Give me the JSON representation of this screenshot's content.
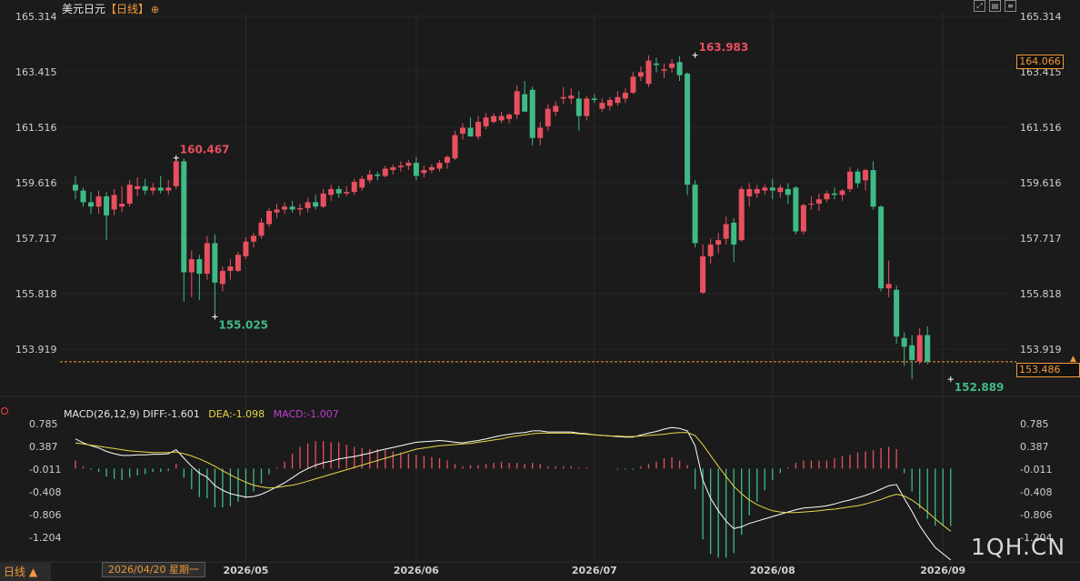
{
  "header": {
    "symbol": "美元日元",
    "timeframe_tag": "【日线】",
    "pin_icon": "target-icon",
    "tools": [
      "expand-icon",
      "layout-icon",
      "menu-icon"
    ]
  },
  "macd": {
    "diff_label": "MACD(26,12,9) DIFF:-1.601",
    "dea_label": "DEA:-1.098",
    "macd_label": "MACD:-1.007"
  },
  "footer": {
    "timeframe_button": "日线 ▲",
    "cursor_date": "2026/04/20 星期一"
  },
  "tags": {
    "current_price": "164.066",
    "last_price": "153.486"
  },
  "watermark": "1QH.CN",
  "colors": {
    "background": "#1b1b1b",
    "up": "#e8505f",
    "down": "#3fba86",
    "diff_line": "#ffffff",
    "dea_line": "#e8d84a",
    "accent": "#f39a3a"
  },
  "chart_data": [
    {
      "type": "candlestick",
      "title": "美元日元",
      "y_ticks": [
        "165.314",
        "163.415",
        "161.516",
        "159.616",
        "157.717",
        "155.818",
        "153.919"
      ],
      "ylim": [
        153.3,
        165.314
      ],
      "x_ticks": [
        {
          "label": "2026/05",
          "index": 22
        },
        {
          "label": "2026/06",
          "index": 44
        },
        {
          "label": "2026/07",
          "index": 67
        },
        {
          "label": "2026/08",
          "index": 90
        },
        {
          "label": "2026/09",
          "index": 112
        }
      ],
      "annotations": [
        {
          "label": "160.467",
          "index": 13,
          "value": 160.467,
          "kind": "high"
        },
        {
          "label": "155.025",
          "index": 18,
          "value": 155.025,
          "kind": "low"
        },
        {
          "label": "163.983",
          "index": 80,
          "value": 163.983,
          "kind": "high"
        },
        {
          "label": "152.889",
          "index": 113,
          "value": 152.889,
          "kind": "low"
        }
      ],
      "reference_line": 153.486,
      "ohlc": [
        [
          159.55,
          159.85,
          159.05,
          159.35
        ],
        [
          159.35,
          159.45,
          158.8,
          158.95
        ],
        [
          158.95,
          159.3,
          158.55,
          158.8
        ],
        [
          158.8,
          159.35,
          158.55,
          159.15
        ],
        [
          159.15,
          159.3,
          157.65,
          158.5
        ],
        [
          158.7,
          159.4,
          158.5,
          159.2
        ],
        [
          158.8,
          159.5,
          158.6,
          158.9
        ],
        [
          158.9,
          159.7,
          158.8,
          159.55
        ],
        [
          159.4,
          159.8,
          159.15,
          159.5
        ],
        [
          159.5,
          159.75,
          159.2,
          159.35
        ],
        [
          159.35,
          159.6,
          159.2,
          159.45
        ],
        [
          159.45,
          159.85,
          159.25,
          159.35
        ],
        [
          159.35,
          159.7,
          159.2,
          159.45
        ],
        [
          159.5,
          160.467,
          159.4,
          160.35
        ],
        [
          160.35,
          160.45,
          155.55,
          156.55
        ],
        [
          156.55,
          157.3,
          155.7,
          157.0
        ],
        [
          157.0,
          157.15,
          155.6,
          156.5
        ],
        [
          156.5,
          157.8,
          156.3,
          157.55
        ],
        [
          157.55,
          157.85,
          155.025,
          156.2
        ],
        [
          156.15,
          156.75,
          155.9,
          156.6
        ],
        [
          156.6,
          157.0,
          156.3,
          156.75
        ],
        [
          156.6,
          157.25,
          156.55,
          157.15
        ],
        [
          157.1,
          157.75,
          157.0,
          157.6
        ],
        [
          157.6,
          157.9,
          157.4,
          157.8
        ],
        [
          157.8,
          158.4,
          157.7,
          158.25
        ],
        [
          158.2,
          158.75,
          158.1,
          158.65
        ],
        [
          158.6,
          158.9,
          158.4,
          158.7
        ],
        [
          158.7,
          158.95,
          158.55,
          158.8
        ],
        [
          158.8,
          159.0,
          158.6,
          158.7
        ],
        [
          158.7,
          158.9,
          158.5,
          158.75
        ],
        [
          158.75,
          159.1,
          158.6,
          158.95
        ],
        [
          158.95,
          159.2,
          158.7,
          158.8
        ],
        [
          158.8,
          159.4,
          158.75,
          159.25
        ],
        [
          159.2,
          159.55,
          159.0,
          159.4
        ],
        [
          159.4,
          159.5,
          159.1,
          159.25
        ],
        [
          159.25,
          159.5,
          159.15,
          159.3
        ],
        [
          159.3,
          159.75,
          159.2,
          159.65
        ],
        [
          159.45,
          159.85,
          159.35,
          159.75
        ],
        [
          159.7,
          160.05,
          159.6,
          159.9
        ],
        [
          159.9,
          160.0,
          159.7,
          159.85
        ],
        [
          159.85,
          160.2,
          159.8,
          160.1
        ],
        [
          160.05,
          160.25,
          159.9,
          160.15
        ],
        [
          160.15,
          160.35,
          160.0,
          160.2
        ],
        [
          160.2,
          160.4,
          160.05,
          160.3
        ],
        [
          160.3,
          160.5,
          159.7,
          159.85
        ],
        [
          159.95,
          160.2,
          159.8,
          160.05
        ],
        [
          160.05,
          160.25,
          159.95,
          160.15
        ],
        [
          160.1,
          160.4,
          160.0,
          160.3
        ],
        [
          160.3,
          160.55,
          160.1,
          160.5
        ],
        [
          160.45,
          161.4,
          160.4,
          161.25
        ],
        [
          161.3,
          161.65,
          161.1,
          161.5
        ],
        [
          161.5,
          161.85,
          161.2,
          161.2
        ],
        [
          161.2,
          161.9,
          161.1,
          161.7
        ],
        [
          161.55,
          162.0,
          161.45,
          161.85
        ],
        [
          161.7,
          162.0,
          161.65,
          161.9
        ],
        [
          161.75,
          162.05,
          161.65,
          161.9
        ],
        [
          161.8,
          162.0,
          161.65,
          161.95
        ],
        [
          161.95,
          162.95,
          161.8,
          162.75
        ],
        [
          162.65,
          163.1,
          162.5,
          162.05
        ],
        [
          162.8,
          162.9,
          160.9,
          161.15
        ],
        [
          161.15,
          161.7,
          160.9,
          161.5
        ],
        [
          161.55,
          162.3,
          161.4,
          162.15
        ],
        [
          162.05,
          162.4,
          161.9,
          162.25
        ],
        [
          162.5,
          162.9,
          162.3,
          162.55
        ],
        [
          162.5,
          162.85,
          162.3,
          162.6
        ],
        [
          162.5,
          162.75,
          161.4,
          161.9
        ],
        [
          161.9,
          162.6,
          161.75,
          162.5
        ],
        [
          162.5,
          162.65,
          162.35,
          162.45
        ],
        [
          162.15,
          162.5,
          162.05,
          162.35
        ],
        [
          162.25,
          162.55,
          162.1,
          162.45
        ],
        [
          162.35,
          162.75,
          162.25,
          162.55
        ],
        [
          162.5,
          162.85,
          162.35,
          162.7
        ],
        [
          162.7,
          163.4,
          162.65,
          163.25
        ],
        [
          163.25,
          163.6,
          163.1,
          163.4
        ],
        [
          163.0,
          163.983,
          162.9,
          163.8
        ],
        [
          163.7,
          163.9,
          163.4,
          163.65
        ],
        [
          163.45,
          163.7,
          163.2,
          163.5
        ],
        [
          163.55,
          163.85,
          163.4,
          163.7
        ],
        [
          163.75,
          163.95,
          163.1,
          163.3
        ],
        [
          163.35,
          163.4,
          159.2,
          159.55
        ],
        [
          159.55,
          159.7,
          157.4,
          157.55
        ],
        [
          155.85,
          157.5,
          155.8,
          157.1
        ],
        [
          157.1,
          157.7,
          156.85,
          157.5
        ],
        [
          157.5,
          157.9,
          157.2,
          157.65
        ],
        [
          157.7,
          158.45,
          157.5,
          158.2
        ],
        [
          158.25,
          158.4,
          156.9,
          157.5
        ],
        [
          157.65,
          159.5,
          157.6,
          159.4
        ],
        [
          159.15,
          159.6,
          158.8,
          159.4
        ],
        [
          159.25,
          159.55,
          159.1,
          159.4
        ],
        [
          159.35,
          159.55,
          159.2,
          159.45
        ],
        [
          159.45,
          159.75,
          159.05,
          159.35
        ],
        [
          159.3,
          159.55,
          159.1,
          159.45
        ],
        [
          159.4,
          159.6,
          158.9,
          159.2
        ],
        [
          159.45,
          159.5,
          157.85,
          157.95
        ],
        [
          157.95,
          158.9,
          157.85,
          158.85
        ],
        [
          158.9,
          159.15,
          158.7,
          158.9
        ],
        [
          158.9,
          159.25,
          158.65,
          159.05
        ],
        [
          159.05,
          159.35,
          158.95,
          159.25
        ],
        [
          159.25,
          159.45,
          159.05,
          159.2
        ],
        [
          159.2,
          159.4,
          159.0,
          159.35
        ],
        [
          159.4,
          160.15,
          159.3,
          160.0
        ],
        [
          160.0,
          160.1,
          159.45,
          159.6
        ],
        [
          159.7,
          160.1,
          159.35,
          160.05
        ],
        [
          160.05,
          160.35,
          158.7,
          158.8
        ],
        [
          158.8,
          158.85,
          155.9,
          156.0
        ],
        [
          156.0,
          156.95,
          155.7,
          156.15
        ],
        [
          155.95,
          156.1,
          154.1,
          154.35
        ],
        [
          154.3,
          154.5,
          153.35,
          154.0
        ],
        [
          154.05,
          154.4,
          152.889,
          153.55
        ],
        [
          153.5,
          154.65,
          153.4,
          154.4
        ],
        [
          154.4,
          154.7,
          153.4,
          153.5
        ]
      ]
    },
    {
      "type": "macd",
      "title": "MACD(26,12,9)",
      "y_ticks": [
        "0.785",
        "0.387",
        "-0.011",
        "-0.408",
        "-0.806",
        "-1.204"
      ],
      "ylim": [
        -1.5,
        0.85
      ],
      "series": [
        {
          "name": "DIFF",
          "color": "#ffffff",
          "values": [
            0.52,
            0.45,
            0.4,
            0.36,
            0.3,
            0.26,
            0.23,
            0.23,
            0.24,
            0.24,
            0.25,
            0.25,
            0.26,
            0.33,
            0.18,
            0.04,
            -0.08,
            -0.15,
            -0.3,
            -0.38,
            -0.44,
            -0.47,
            -0.5,
            -0.49,
            -0.45,
            -0.39,
            -0.32,
            -0.25,
            -0.16,
            -0.07,
            0.0,
            0.06,
            0.1,
            0.13,
            0.17,
            0.19,
            0.21,
            0.24,
            0.27,
            0.31,
            0.34,
            0.37,
            0.4,
            0.43,
            0.46,
            0.47,
            0.48,
            0.49,
            0.48,
            0.46,
            0.45,
            0.47,
            0.49,
            0.52,
            0.55,
            0.58,
            0.6,
            0.62,
            0.63,
            0.66,
            0.66,
            0.64,
            0.64,
            0.64,
            0.64,
            0.62,
            0.61,
            0.59,
            0.58,
            0.57,
            0.56,
            0.55,
            0.55,
            0.59,
            0.62,
            0.65,
            0.69,
            0.72,
            0.7,
            0.66,
            0.4,
            -0.2,
            -0.52,
            -0.74,
            -0.92,
            -1.05,
            -1.02,
            -0.96,
            -0.92,
            -0.88,
            -0.84,
            -0.8,
            -0.76,
            -0.72,
            -0.69,
            -0.68,
            -0.67,
            -0.65,
            -0.62,
            -0.58,
            -0.55,
            -0.51,
            -0.47,
            -0.42,
            -0.36,
            -0.3,
            -0.28,
            -0.52,
            -0.75,
            -1.0,
            -1.2,
            -1.38,
            -1.49,
            -1.601
          ]
        },
        {
          "name": "DEA",
          "color": "#e8d84a",
          "values": [
            0.45,
            0.43,
            0.41,
            0.39,
            0.37,
            0.35,
            0.33,
            0.31,
            0.3,
            0.29,
            0.28,
            0.28,
            0.28,
            0.29,
            0.26,
            0.22,
            0.17,
            0.11,
            0.04,
            -0.04,
            -0.11,
            -0.18,
            -0.24,
            -0.29,
            -0.32,
            -0.34,
            -0.33,
            -0.31,
            -0.29,
            -0.26,
            -0.22,
            -0.18,
            -0.14,
            -0.1,
            -0.06,
            -0.02,
            0.02,
            0.06,
            0.1,
            0.14,
            0.18,
            0.22,
            0.26,
            0.3,
            0.34,
            0.36,
            0.38,
            0.4,
            0.41,
            0.42,
            0.43,
            0.44,
            0.46,
            0.48,
            0.5,
            0.52,
            0.55,
            0.57,
            0.59,
            0.61,
            0.62,
            0.62,
            0.62,
            0.62,
            0.62,
            0.61,
            0.6,
            0.59,
            0.58,
            0.57,
            0.57,
            0.56,
            0.56,
            0.57,
            0.58,
            0.59,
            0.6,
            0.62,
            0.63,
            0.63,
            0.58,
            0.42,
            0.23,
            0.04,
            -0.14,
            -0.31,
            -0.44,
            -0.55,
            -0.63,
            -0.69,
            -0.74,
            -0.76,
            -0.77,
            -0.77,
            -0.76,
            -0.75,
            -0.74,
            -0.72,
            -0.71,
            -0.69,
            -0.67,
            -0.65,
            -0.62,
            -0.58,
            -0.54,
            -0.49,
            -0.45,
            -0.48,
            -0.55,
            -0.65,
            -0.76,
            -0.88,
            -0.99,
            -1.098
          ]
        },
        {
          "name": "MACD",
          "color": "#c43bd1",
          "values": [
            0.14,
            0.04,
            -0.02,
            -0.06,
            -0.14,
            -0.18,
            -0.2,
            -0.16,
            -0.12,
            -0.1,
            -0.06,
            -0.06,
            -0.04,
            0.08,
            -0.16,
            -0.36,
            -0.5,
            -0.52,
            -0.68,
            -0.68,
            -0.66,
            -0.58,
            -0.52,
            -0.4,
            -0.26,
            -0.1,
            0.02,
            0.12,
            0.26,
            0.38,
            0.44,
            0.48,
            0.48,
            0.46,
            0.46,
            0.42,
            0.38,
            0.36,
            0.34,
            0.34,
            0.32,
            0.3,
            0.28,
            0.26,
            0.24,
            0.22,
            0.2,
            0.18,
            0.14,
            0.08,
            0.04,
            0.06,
            0.06,
            0.08,
            0.1,
            0.12,
            0.1,
            0.1,
            0.08,
            0.1,
            0.08,
            0.04,
            0.04,
            0.04,
            0.04,
            0.02,
            0.02,
            0.0,
            0.0,
            0.0,
            -0.02,
            -0.02,
            -0.02,
            0.04,
            0.08,
            0.12,
            0.18,
            0.2,
            0.14,
            0.06,
            -0.36,
            -1.24,
            -1.5,
            -1.56,
            -1.56,
            -1.48,
            -1.16,
            -0.82,
            -0.58,
            -0.38,
            -0.2,
            -0.08,
            0.02,
            0.1,
            0.14,
            0.14,
            0.14,
            0.14,
            0.18,
            0.22,
            0.24,
            0.28,
            0.3,
            0.32,
            0.36,
            0.38,
            0.34,
            -0.08,
            -0.4,
            -0.7,
            -0.88,
            -1.0,
            -1.0,
            -1.007
          ]
        }
      ]
    }
  ]
}
